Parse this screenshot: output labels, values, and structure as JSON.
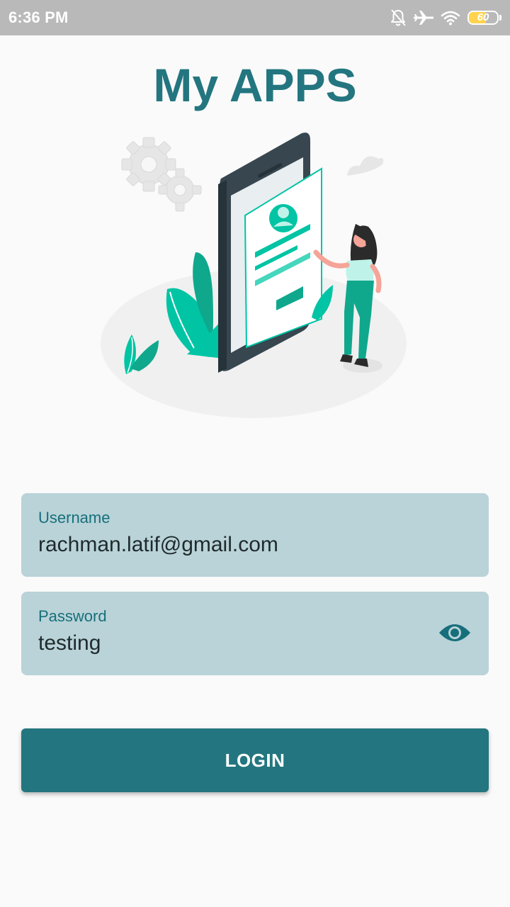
{
  "status_bar": {
    "time": "6:36 PM",
    "icons": [
      "bell-off-icon",
      "airplane-icon",
      "wifi-icon",
      "battery-icon"
    ],
    "battery_level": "60",
    "battery_fraction": 0.6
  },
  "app": {
    "title": "My APPS"
  },
  "illustration": {
    "subject": "login-illustration"
  },
  "form": {
    "username": {
      "label": "Username",
      "value": "rachman.latif@gmail.com"
    },
    "password": {
      "label": "Password",
      "value": "testing",
      "toggle_icon": "eye-icon"
    },
    "login_label": "LOGIN"
  },
  "colors": {
    "primary": "#23767f",
    "field_background": "#b9d3d8",
    "accent_green": "#00c4a4",
    "status_bar": "#b9b9b9"
  }
}
